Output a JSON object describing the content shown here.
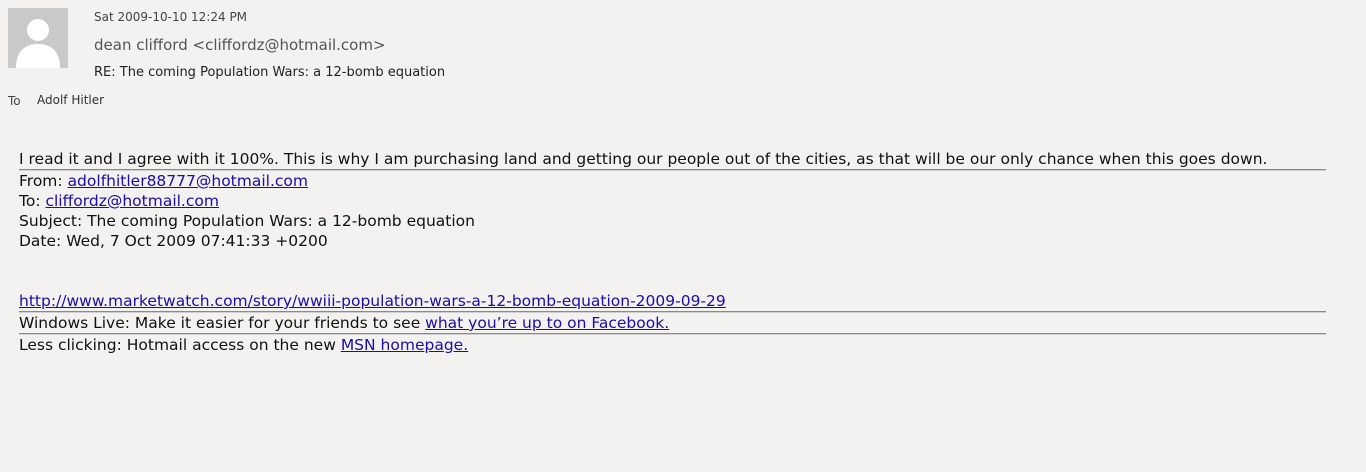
{
  "header": {
    "date": "Sat 2009-10-10 12:24 PM",
    "sender": "dean clifford <cliffordz@hotmail.com>",
    "subject": "RE: The coming Population Wars: a 12-bomb equation",
    "to_label": "To",
    "to_value": "Adolf Hitler",
    "avatar_icon": "person-silhouette-icon"
  },
  "body": {
    "reply_text": "I read it and I agree with it 100%. This is why I am purchasing land and getting our people out of the cities, as that will be our only chance when this goes down.",
    "quoted": {
      "from_label": "From: ",
      "from_value": "adolfhitler88777@hotmail.com",
      "to_label": "To: ",
      "to_value": "cliffordz@hotmail.com",
      "subject_line": "Subject: The coming Population Wars: a 12-bomb equation",
      "date_line": "Date: Wed, 7 Oct 2009 07:41:33 +0200",
      "link": "http://www.marketwatch.com/story/wwiii-population-wars-a-12-bomb-equation-2009-09-29"
    },
    "footer1_text": "Windows Live: Make it easier for your friends to see ",
    "footer1_link": "what you’re up to on Facebook.",
    "footer2_text": "Less clicking: Hotmail access on the new ",
    "footer2_link": "MSN homepage."
  },
  "colors": {
    "background": "#f3f2f1",
    "link": "#1a0dab",
    "avatar": "#c7c7c7"
  }
}
